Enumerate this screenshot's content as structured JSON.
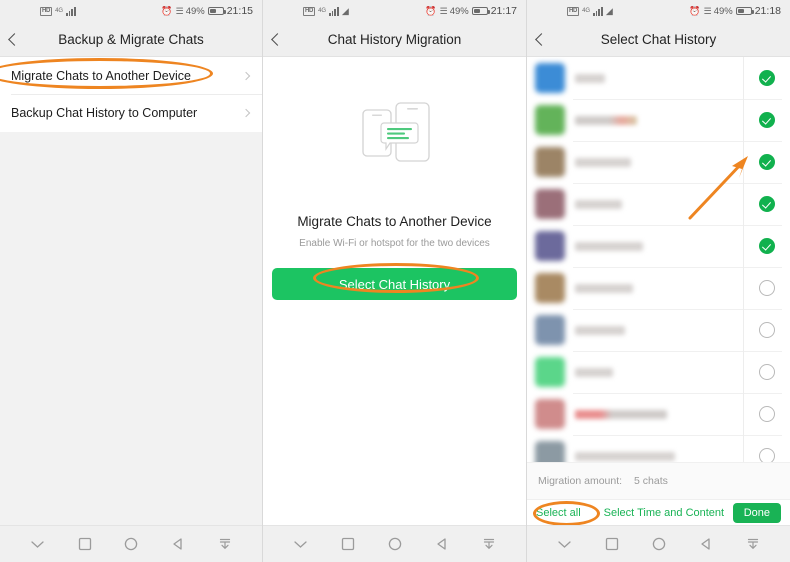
{
  "statusbar": {
    "hd_label": "HD",
    "signal_sup": "4G",
    "battery_pct": "49%",
    "times": {
      "left": "21:15",
      "mid": "21:17",
      "right": "21:18"
    }
  },
  "left_screen": {
    "title": "Backup & Migrate Chats",
    "back_icon": "back-chevron-icon",
    "items": [
      {
        "label": "Migrate Chats to Another Device",
        "highlighted": true
      },
      {
        "label": "Backup Chat History to Computer",
        "highlighted": false
      }
    ]
  },
  "mid_screen": {
    "title": "Chat History Migration",
    "illustration": "two-phones-chat-bubble-icon",
    "heading": "Migrate Chats to Another Device",
    "subtext": "Enable Wi-Fi or hotspot for the two devices",
    "cta_label": "Select Chat History",
    "cta_color": "#1CC462"
  },
  "right_screen": {
    "title": "Select Chat History",
    "chats": [
      {
        "avatar_color": "#3C8CD6",
        "name_width": 30,
        "name_style": "plain",
        "checked": true
      },
      {
        "avatar_color": "#63B35A",
        "name_width": 62,
        "name_style": "tint",
        "checked": true
      },
      {
        "avatar_color": "#9C8466",
        "name_width": 56,
        "name_style": "plain",
        "checked": true
      },
      {
        "avatar_color": "#9B6F79",
        "name_width": 47,
        "name_style": "plain",
        "checked": true
      },
      {
        "avatar_color": "#6C6A9C",
        "name_width": 68,
        "name_style": "plain",
        "checked": true
      },
      {
        "avatar_color": "#A98A63",
        "name_width": 58,
        "name_style": "plain",
        "checked": false
      },
      {
        "avatar_color": "#7E93AE",
        "name_width": 50,
        "name_style": "plain",
        "checked": false
      },
      {
        "avatar_color": "#5BD68A",
        "name_width": 38,
        "name_style": "plain",
        "checked": false
      },
      {
        "avatar_color": "#D08C8C",
        "name_width": 92,
        "name_style": "red",
        "checked": false
      },
      {
        "avatar_color": "#8C9AA3",
        "name_width": 100,
        "name_style": "plain",
        "checked": false
      }
    ],
    "migration_label": "Migration amount:",
    "migration_value": "5 chats",
    "select_all_label": "Select all",
    "select_time_label": "Select Time and Content",
    "done_label": "Done"
  },
  "navbar": {
    "icons": [
      "chevron-down-icon",
      "square-icon",
      "circle-icon",
      "triangle-back-icon",
      "download-icon"
    ]
  },
  "annotations": {
    "highlight_color": "#EE8521",
    "arrow_name": "orange-pointer-arrow"
  }
}
